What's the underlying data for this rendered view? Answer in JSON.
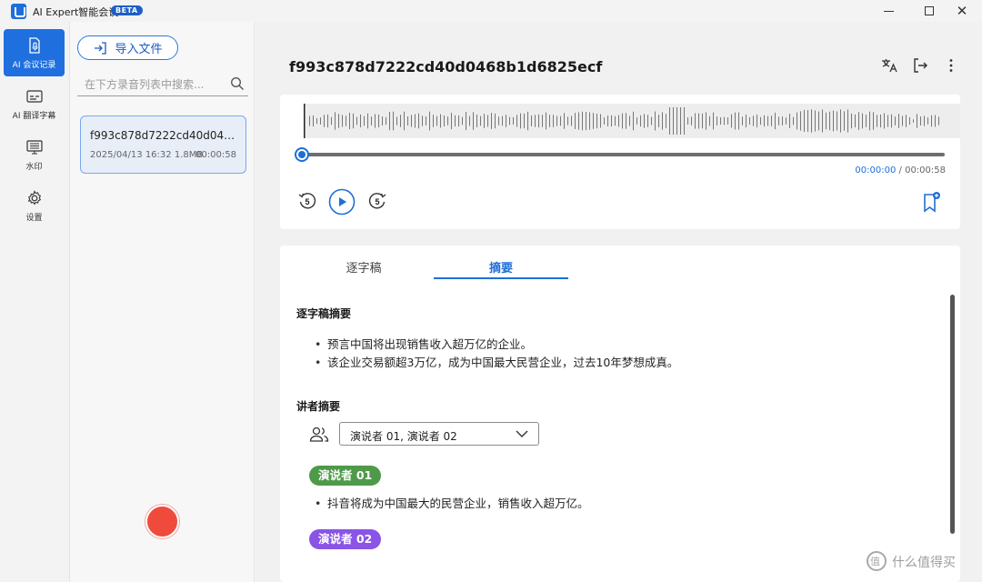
{
  "window": {
    "app_title": "AI Expert智能会议",
    "badge": "BETA"
  },
  "rail": {
    "items": [
      {
        "label": "AI 会议记录",
        "icon": "document-mic-icon",
        "active": true
      },
      {
        "label": "AI 翻译字幕",
        "icon": "subtitle-icon"
      },
      {
        "label": "水印",
        "icon": "watermark-monitor-icon"
      },
      {
        "label": "设置",
        "icon": "gear-icon"
      }
    ]
  },
  "list": {
    "import_label": "导入文件",
    "search_placeholder": "在下方录音列表中搜索...",
    "files": [
      {
        "name": "f993c878d7222cd40d0468b1...",
        "date": "2025/04/13 16:32",
        "size": "1.8MB",
        "duration": "00:00:58"
      }
    ]
  },
  "main": {
    "title": "f993c878d7222cd40d0468b1d6825ecf",
    "player": {
      "current_time": "00:00:00",
      "separator": "/",
      "total_time": "00:00:58",
      "progress": 0.0,
      "skip_back_label": "5",
      "skip_forward_label": "5"
    },
    "tabs": [
      {
        "label": "逐字稿",
        "active": false
      },
      {
        "label": "摘要",
        "active": true
      }
    ],
    "summary": {
      "transcript_title": "逐字稿摘要",
      "transcript_points": [
        "预言中国将出现销售收入超万亿的企业。",
        "该企业交易额超3万亿，成为中国最大民营企业，过去10年梦想成真。"
      ],
      "speaker_title": "讲者摘要",
      "speaker_filter": "演说者 01, 演说者 02",
      "speakers": [
        {
          "name": "演说者 01",
          "color": "#4f9a4a",
          "points": [
            "抖音将成为中国最大的民营企业，销售收入超万亿。"
          ]
        },
        {
          "name": "演说者 02",
          "color": "#8a54e6",
          "points": []
        }
      ]
    }
  },
  "watermark": {
    "text": "什么值得买"
  },
  "colors": {
    "accent": "#1f6fde",
    "record": "#f04a3c"
  }
}
